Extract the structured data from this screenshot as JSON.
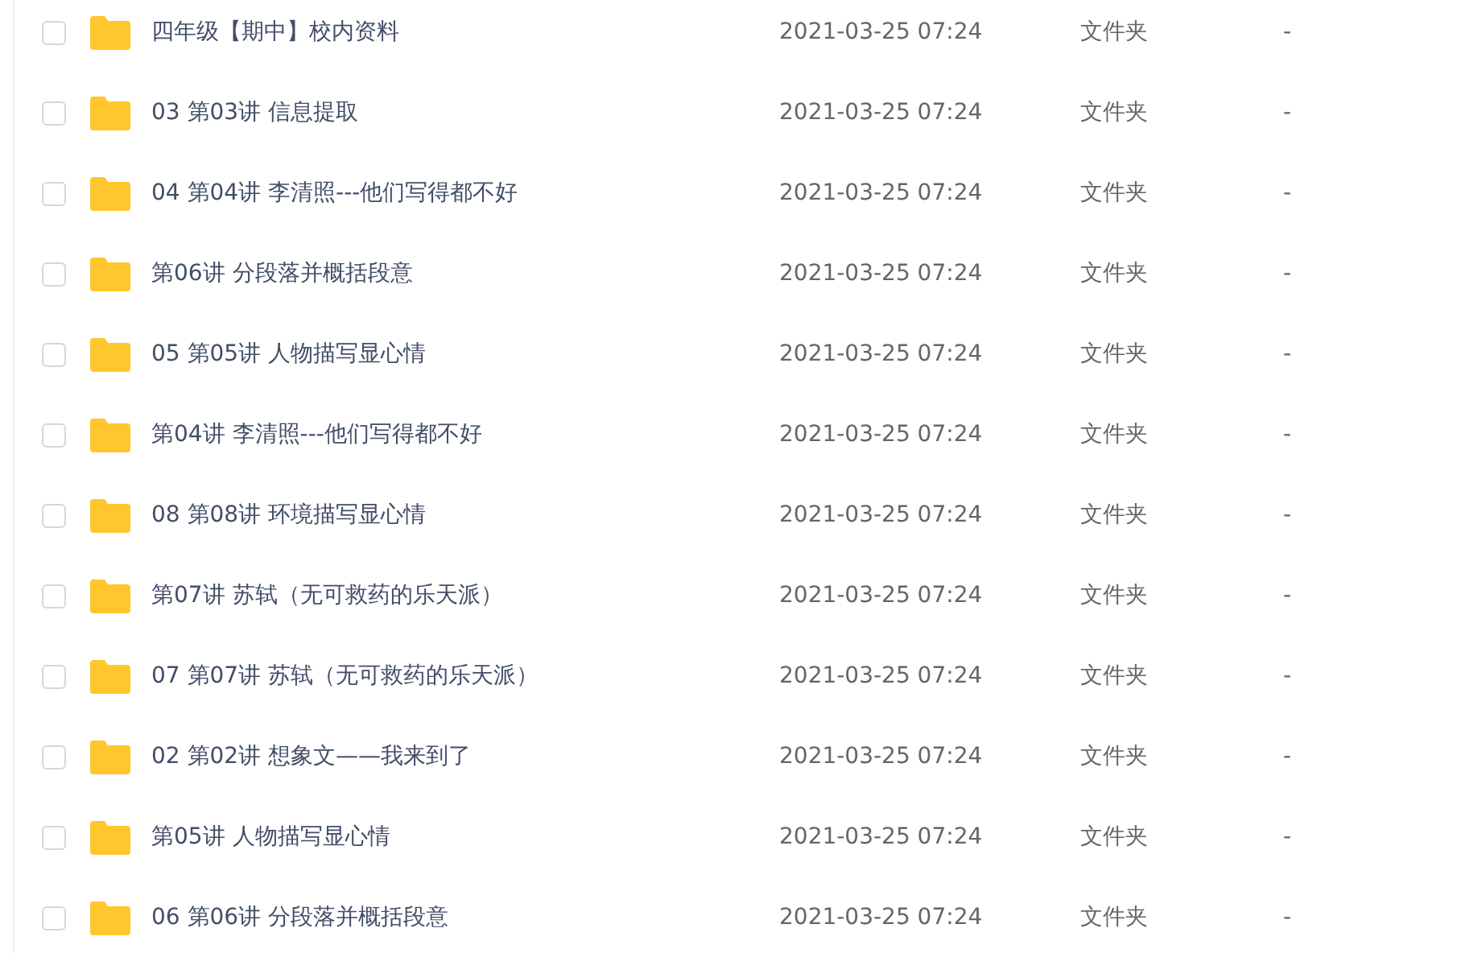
{
  "files": [
    {
      "name": "四年级【期中】校内资料",
      "modified": "2021-03-25 07:24",
      "type": "文件夹",
      "size": "-",
      "checked": false
    },
    {
      "name": "03 第03讲 信息提取",
      "modified": "2021-03-25 07:24",
      "type": "文件夹",
      "size": "-",
      "checked": false
    },
    {
      "name": "04 第04讲 李清照---他们写得都不好",
      "modified": "2021-03-25 07:24",
      "type": "文件夹",
      "size": "-",
      "checked": false
    },
    {
      "name": "第06讲 分段落并概括段意",
      "modified": "2021-03-25 07:24",
      "type": "文件夹",
      "size": "-",
      "checked": false
    },
    {
      "name": "05 第05讲 人物描写显心情",
      "modified": "2021-03-25 07:24",
      "type": "文件夹",
      "size": "-",
      "checked": false
    },
    {
      "name": "第04讲 李清照---他们写得都不好",
      "modified": "2021-03-25 07:24",
      "type": "文件夹",
      "size": "-",
      "checked": false
    },
    {
      "name": "08 第08讲 环境描写显心情",
      "modified": "2021-03-25 07:24",
      "type": "文件夹",
      "size": "-",
      "checked": false
    },
    {
      "name": "第07讲 苏轼（无可救药的乐天派）",
      "modified": "2021-03-25 07:24",
      "type": "文件夹",
      "size": "-",
      "checked": false
    },
    {
      "name": "07 第07讲 苏轼（无可救药的乐天派）",
      "modified": "2021-03-25 07:24",
      "type": "文件夹",
      "size": "-",
      "checked": false
    },
    {
      "name": "02 第02讲 想象文——我来到了",
      "modified": "2021-03-25 07:24",
      "type": "文件夹",
      "size": "-",
      "checked": false
    },
    {
      "name": "第05讲 人物描写显心情",
      "modified": "2021-03-25 07:24",
      "type": "文件夹",
      "size": "-",
      "checked": false
    },
    {
      "name": "06 第06讲 分段落并概括段意",
      "modified": "2021-03-25 07:24",
      "type": "文件夹",
      "size": "-",
      "checked": false
    }
  ]
}
